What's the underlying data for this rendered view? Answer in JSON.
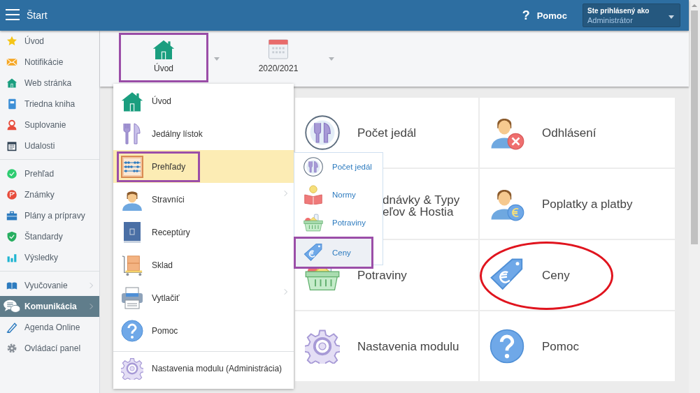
{
  "header": {
    "title": "Štart",
    "help_icon": "?",
    "help": "Pomoc",
    "user": {
      "label": "Ste prihlásený ako",
      "name": "Administrátor"
    }
  },
  "sidebar": {
    "groups": [
      [
        {
          "label": "Úvod",
          "selected": false,
          "has_submenu": false
        },
        {
          "label": "Notifikácie",
          "selected": false,
          "has_submenu": false
        },
        {
          "label": "Web stránka",
          "selected": false,
          "has_submenu": false
        },
        {
          "label": "Triedna kniha",
          "selected": false,
          "has_submenu": false
        },
        {
          "label": "Suplovanie",
          "selected": false,
          "has_submenu": false
        },
        {
          "label": "Udalosti",
          "selected": false,
          "has_submenu": false
        }
      ],
      [
        {
          "label": "Prehľad",
          "selected": false,
          "has_submenu": false
        },
        {
          "label": "Známky",
          "selected": false,
          "has_submenu": false
        },
        {
          "label": "Plány a prípravy",
          "selected": false,
          "has_submenu": false
        },
        {
          "label": "Štandardy",
          "selected": false,
          "has_submenu": false
        },
        {
          "label": "Výsledky",
          "selected": false,
          "has_submenu": false
        }
      ],
      [
        {
          "label": "Vyučovanie",
          "selected": false,
          "has_submenu": true
        },
        {
          "label": "Komunikácia",
          "selected": true,
          "has_submenu": true
        },
        {
          "label": "Agenda Online",
          "selected": false,
          "has_submenu": false
        },
        {
          "label": "Ovládací panel",
          "selected": false,
          "has_submenu": false
        }
      ]
    ]
  },
  "toolbar": {
    "tabs": [
      {
        "label": "Úvod",
        "highlighted": true
      },
      {
        "label": "2020/2021",
        "highlighted": false
      }
    ]
  },
  "menu": {
    "groups": [
      [
        {
          "label": "Úvod",
          "selected": false,
          "highlighted": false,
          "has_submenu": false
        },
        {
          "label": "Jedálny lístok",
          "selected": false,
          "highlighted": false,
          "has_submenu": false
        },
        {
          "label": "Prehľady",
          "selected": true,
          "highlighted": true,
          "has_submenu": false
        },
        {
          "label": "Stravníci",
          "selected": false,
          "highlighted": false,
          "has_submenu": true
        },
        {
          "label": "Receptúry",
          "selected": false,
          "highlighted": false,
          "has_submenu": false
        },
        {
          "label": "Sklad",
          "selected": false,
          "highlighted": false,
          "has_submenu": false
        },
        {
          "label": "Vytlačiť",
          "selected": false,
          "highlighted": false,
          "has_submenu": true
        },
        {
          "label": "Pomoc",
          "selected": false,
          "highlighted": false,
          "has_submenu": false
        }
      ],
      [
        {
          "label": "Nastavenia modulu (Administrácia)",
          "selected": false,
          "highlighted": false,
          "has_submenu": false
        }
      ]
    ]
  },
  "submenu": {
    "items": [
      {
        "label": "Počet jedál",
        "selected": false,
        "highlighted": false
      },
      {
        "label": "Normy",
        "selected": false,
        "highlighted": false
      },
      {
        "label": "Potraviny",
        "selected": false,
        "highlighted": false
      },
      {
        "label": "Ceny",
        "selected": true,
        "highlighted": true
      }
    ]
  },
  "tiles": [
    {
      "lines": [
        "Počet jedál"
      ],
      "covered": false,
      "circled": false
    },
    {
      "lines": [
        "Odhlásení"
      ],
      "covered": false,
      "circled": false
    },
    {
      "lines": [
        "dnávky & Typy",
        "eľov & Hostia"
      ],
      "covered": true,
      "circled": false
    },
    {
      "lines": [
        "Poplatky a platby"
      ],
      "covered": false,
      "circled": false
    },
    {
      "lines": [
        "Potraviny"
      ],
      "covered": false,
      "circled": false
    },
    {
      "lines": [
        "Ceny"
      ],
      "covered": false,
      "circled": true
    },
    {
      "lines": [
        "Nastavenia modulu"
      ],
      "covered": false,
      "circled": false
    },
    {
      "lines": [
        "Pomoc"
      ],
      "covered": false,
      "circled": false
    }
  ]
}
